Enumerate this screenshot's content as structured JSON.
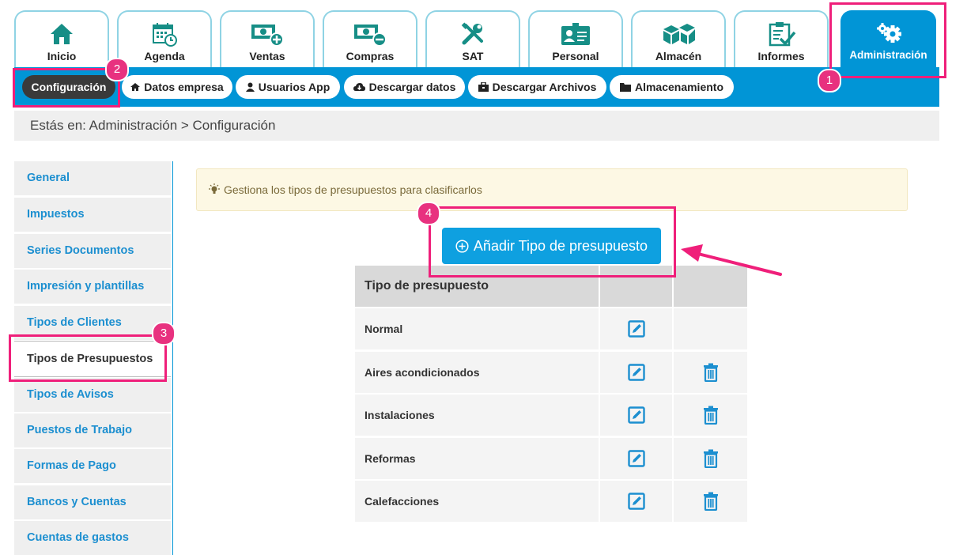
{
  "tabs": [
    {
      "label": "Inicio",
      "icon": "home-icon"
    },
    {
      "label": "Agenda",
      "icon": "calendar-icon"
    },
    {
      "label": "Ventas",
      "icon": "money-plus-icon"
    },
    {
      "label": "Compras",
      "icon": "money-minus-icon"
    },
    {
      "label": "SAT",
      "icon": "tools-icon"
    },
    {
      "label": "Personal",
      "icon": "id-card-icon"
    },
    {
      "label": "Almacén",
      "icon": "boxes-icon"
    },
    {
      "label": "Informes",
      "icon": "clipboard-check-icon"
    },
    {
      "label": "Administración",
      "icon": "gears-icon",
      "active": true
    }
  ],
  "subnav": [
    {
      "label": "Configuración",
      "active": true
    },
    {
      "label": "Datos empresa",
      "icon": "home-icon"
    },
    {
      "label": "Usuarios App",
      "icon": "user-icon"
    },
    {
      "label": "Descargar datos",
      "icon": "cloud-download-icon"
    },
    {
      "label": "Descargar Archivos",
      "icon": "briefcase-icon"
    },
    {
      "label": "Almacenamiento",
      "icon": "folder-icon"
    }
  ],
  "breadcrumb": "Estás en: Administración > Configuración",
  "sidebar": [
    {
      "label": "General"
    },
    {
      "label": "Impuestos"
    },
    {
      "label": "Series Documentos"
    },
    {
      "label": "Impresión y plantillas"
    },
    {
      "label": "Tipos de Clientes"
    },
    {
      "label": "Tipos de Presupuestos",
      "active": true
    },
    {
      "label": "Tipos de Avisos"
    },
    {
      "label": "Puestos de Trabajo"
    },
    {
      "label": "Formas de Pago"
    },
    {
      "label": "Bancos y Cuentas"
    },
    {
      "label": "Cuentas de gastos"
    }
  ],
  "info_text": "Gestiona los tipos de presupuestos para clasificarlos",
  "add_button_label": "Añadir Tipo de presupuesto",
  "table": {
    "header": "Tipo de presupuesto",
    "rows": [
      {
        "name": "Normal",
        "deletable": false
      },
      {
        "name": "Aires acondicionados",
        "deletable": true
      },
      {
        "name": "Instalaciones",
        "deletable": true
      },
      {
        "name": "Reformas",
        "deletable": true
      },
      {
        "name": "Calefacciones",
        "deletable": true
      }
    ]
  },
  "annotations": [
    "1",
    "2",
    "3",
    "4"
  ],
  "colors": {
    "primary": "#0195d6",
    "button": "#0ea0e0",
    "highlight": "#ef1f7a",
    "badge": "#e8317f",
    "link": "#1c8fd0",
    "info_bg": "#fdf8e4"
  }
}
